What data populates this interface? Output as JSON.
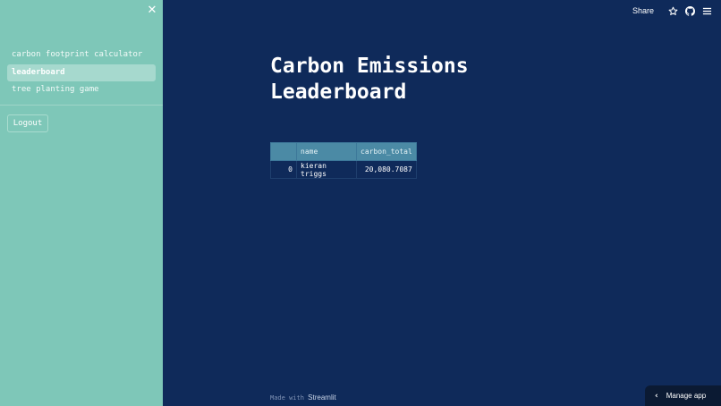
{
  "sidebar": {
    "close_glyph": "✕",
    "items": [
      {
        "label": "carbon footprint calculator",
        "active": false
      },
      {
        "label": "leaderboard",
        "active": true
      },
      {
        "label": "tree planting game",
        "active": false
      }
    ],
    "logout_label": "Logout"
  },
  "header": {
    "share_label": "Share",
    "icons": [
      "star-icon",
      "github-icon",
      "hamburger-menu-icon"
    ]
  },
  "main": {
    "title": "Carbon Emissions Leaderboard",
    "table": {
      "columns": [
        "",
        "name",
        "carbon_total"
      ],
      "rows": [
        {
          "index": "0",
          "name": "kieran triggs",
          "carbon_total": "20,080.7087"
        }
      ]
    }
  },
  "footer": {
    "made_with": "Made with",
    "brand": "Streamlit"
  },
  "manage_app": {
    "label": "Manage app",
    "chevron": "‹"
  },
  "colors": {
    "sidebar_bg": "#7ec7b8",
    "main_bg": "#0f2a5a",
    "table_header_bg": "#4b8aa5"
  }
}
